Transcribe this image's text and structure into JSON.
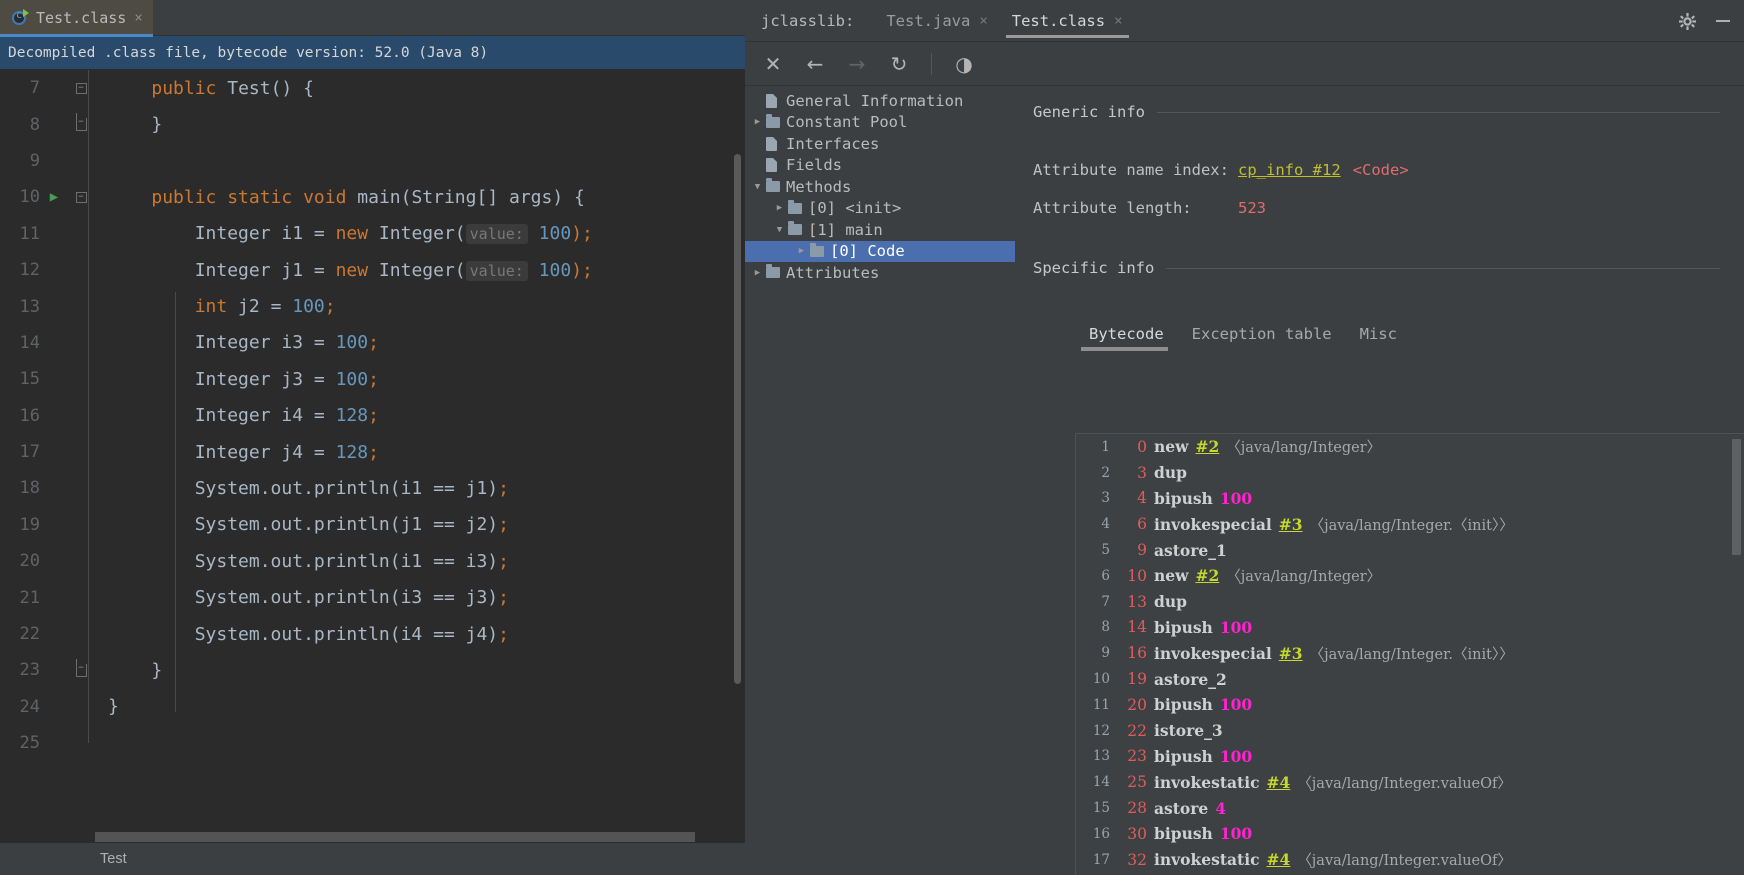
{
  "editor": {
    "tab": {
      "title": "Test.class",
      "close": "×",
      "icon": "java-class-icon"
    },
    "notice": "Decompiled .class file, bytecode version: 52.0 (Java 8)",
    "breadcrumb": "Test",
    "lines": [
      {
        "num": "7",
        "fold": "start",
        "run": false,
        "tokens": [
          {
            "t": "    ",
            "c": "pl"
          },
          {
            "t": "public",
            "c": "kw"
          },
          {
            "t": " Test() {",
            "c": "pl"
          }
        ]
      },
      {
        "num": "8",
        "fold": "end",
        "run": false,
        "tokens": [
          {
            "t": "    }",
            "c": "pl"
          }
        ]
      },
      {
        "num": "9",
        "fold": "none",
        "run": false,
        "tokens": []
      },
      {
        "num": "10",
        "fold": "start",
        "run": true,
        "tokens": [
          {
            "t": "    ",
            "c": "pl"
          },
          {
            "t": "public static void",
            "c": "kw"
          },
          {
            "t": " main(String[] args) {",
            "c": "pl"
          }
        ]
      },
      {
        "num": "11",
        "fold": "none",
        "run": false,
        "tokens": [
          {
            "t": "        Integer i1 = ",
            "c": "pl"
          },
          {
            "t": "new",
            "c": "kw"
          },
          {
            "t": " Integer(",
            "c": "pl"
          },
          {
            "t": "value:",
            "c": "hint"
          },
          {
            "t": " ",
            "c": "pl"
          },
          {
            "t": "100",
            "c": "num"
          },
          {
            "t": ");",
            "c": "sc"
          }
        ]
      },
      {
        "num": "12",
        "fold": "none",
        "run": false,
        "tokens": [
          {
            "t": "        Integer j1 = ",
            "c": "pl"
          },
          {
            "t": "new",
            "c": "kw"
          },
          {
            "t": " Integer(",
            "c": "pl"
          },
          {
            "t": "value:",
            "c": "hint"
          },
          {
            "t": " ",
            "c": "pl"
          },
          {
            "t": "100",
            "c": "num"
          },
          {
            "t": ");",
            "c": "sc"
          }
        ]
      },
      {
        "num": "13",
        "fold": "none",
        "run": false,
        "tokens": [
          {
            "t": "        ",
            "c": "pl"
          },
          {
            "t": "int",
            "c": "kw"
          },
          {
            "t": " j2 = ",
            "c": "pl"
          },
          {
            "t": "100",
            "c": "num"
          },
          {
            "t": ";",
            "c": "sc"
          }
        ]
      },
      {
        "num": "14",
        "fold": "none",
        "run": false,
        "tokens": [
          {
            "t": "        Integer i3 = ",
            "c": "pl"
          },
          {
            "t": "100",
            "c": "num"
          },
          {
            "t": ";",
            "c": "sc"
          }
        ]
      },
      {
        "num": "15",
        "fold": "none",
        "run": false,
        "tokens": [
          {
            "t": "        Integer j3 = ",
            "c": "pl"
          },
          {
            "t": "100",
            "c": "num"
          },
          {
            "t": ";",
            "c": "sc"
          }
        ]
      },
      {
        "num": "16",
        "fold": "none",
        "run": false,
        "tokens": [
          {
            "t": "        Integer i4 = ",
            "c": "pl"
          },
          {
            "t": "128",
            "c": "num"
          },
          {
            "t": ";",
            "c": "sc"
          }
        ]
      },
      {
        "num": "17",
        "fold": "none",
        "run": false,
        "tokens": [
          {
            "t": "        Integer j4 = ",
            "c": "pl"
          },
          {
            "t": "128",
            "c": "num"
          },
          {
            "t": ";",
            "c": "sc"
          }
        ]
      },
      {
        "num": "18",
        "fold": "none",
        "run": false,
        "tokens": [
          {
            "t": "        System.out.println(i1 == j1)",
            "c": "pl"
          },
          {
            "t": ";",
            "c": "sc"
          }
        ]
      },
      {
        "num": "19",
        "fold": "none",
        "run": false,
        "tokens": [
          {
            "t": "        System.out.println(j1 == j2)",
            "c": "pl"
          },
          {
            "t": ";",
            "c": "sc"
          }
        ]
      },
      {
        "num": "20",
        "fold": "none",
        "run": false,
        "tokens": [
          {
            "t": "        System.out.println(i1 == i3)",
            "c": "pl"
          },
          {
            "t": ";",
            "c": "sc"
          }
        ]
      },
      {
        "num": "21",
        "fold": "none",
        "run": false,
        "tokens": [
          {
            "t": "        System.out.println(i3 == j3)",
            "c": "pl"
          },
          {
            "t": ";",
            "c": "sc"
          }
        ]
      },
      {
        "num": "22",
        "fold": "none",
        "run": false,
        "tokens": [
          {
            "t": "        System.out.println(i4 == j4)",
            "c": "pl"
          },
          {
            "t": ";",
            "c": "sc"
          }
        ]
      },
      {
        "num": "23",
        "fold": "end",
        "run": false,
        "tokens": [
          {
            "t": "    }",
            "c": "pl"
          }
        ]
      },
      {
        "num": "24",
        "fold": "none",
        "run": false,
        "tokens": [
          {
            "t": "}",
            "c": "pl"
          }
        ]
      },
      {
        "num": "25",
        "fold": "none",
        "run": false,
        "tokens": []
      }
    ]
  },
  "jclasslib": {
    "label": "jclasslib:",
    "tabs": [
      {
        "label": "Test.java",
        "active": false,
        "close": "×"
      },
      {
        "label": "Test.class",
        "active": true,
        "close": "×"
      }
    ],
    "window_controls": [
      {
        "name": "gear-icon",
        "label": ""
      },
      {
        "name": "minimize-icon",
        "label": ""
      }
    ],
    "toolbar": [
      {
        "name": "close-icon",
        "glyph": "✕",
        "dim": false
      },
      {
        "name": "back-icon",
        "glyph": "←",
        "dim": false
      },
      {
        "name": "forward-icon",
        "glyph": "→",
        "dim": true
      },
      {
        "name": "reload-icon",
        "glyph": "↻",
        "dim": false
      },
      {
        "name": "browse-icon",
        "glyph": "◑",
        "dim": false
      }
    ],
    "tree": [
      {
        "label": "General Information",
        "indent": 1,
        "arrow": "none",
        "icon": "file",
        "selected": false
      },
      {
        "label": "Constant Pool",
        "indent": 1,
        "arrow": "collapsed",
        "icon": "folder",
        "selected": false
      },
      {
        "label": "Interfaces",
        "indent": 1,
        "arrow": "none",
        "icon": "file",
        "selected": false
      },
      {
        "label": "Fields",
        "indent": 1,
        "arrow": "none",
        "icon": "file",
        "selected": false
      },
      {
        "label": "Methods",
        "indent": 1,
        "arrow": "expanded",
        "icon": "folder",
        "selected": false
      },
      {
        "label": "[0] <init>",
        "indent": 2,
        "arrow": "collapsed",
        "icon": "folder",
        "selected": false
      },
      {
        "label": "[1] main",
        "indent": 2,
        "arrow": "expanded",
        "icon": "folder",
        "selected": false
      },
      {
        "label": "[0] Code",
        "indent": 3,
        "arrow": "collapsed",
        "icon": "folder",
        "selected": true
      },
      {
        "label": "Attributes",
        "indent": 1,
        "arrow": "collapsed",
        "icon": "folder",
        "selected": false
      }
    ],
    "detail": {
      "generic_header": "Generic info",
      "specific_header": "Specific info",
      "rows": [
        {
          "key": "Attribute name index:",
          "link": "cp_info #12",
          "extra": "<Code>",
          "value": ""
        },
        {
          "key": "Attribute length:",
          "link": "",
          "extra": "",
          "value": "523"
        }
      ]
    },
    "bytecode_tabs": [
      {
        "label": "Bytecode",
        "active": true
      },
      {
        "label": "Exception table",
        "active": false
      },
      {
        "label": "Misc",
        "active": false
      }
    ],
    "bytecode": [
      {
        "idx": "1",
        "offset": "0",
        "op": "new",
        "ref": "#2",
        "lit": "",
        "desc": "〈java/lang/Integer〉"
      },
      {
        "idx": "2",
        "offset": "3",
        "op": "dup",
        "ref": "",
        "lit": "",
        "desc": ""
      },
      {
        "idx": "3",
        "offset": "4",
        "op": "bipush",
        "ref": "",
        "lit": "100",
        "desc": ""
      },
      {
        "idx": "4",
        "offset": "6",
        "op": "invokespecial",
        "ref": "#3",
        "lit": "",
        "desc": "〈java/lang/Integer.〈init〉〉"
      },
      {
        "idx": "5",
        "offset": "9",
        "op": "astore_1",
        "ref": "",
        "lit": "",
        "desc": ""
      },
      {
        "idx": "6",
        "offset": "10",
        "op": "new",
        "ref": "#2",
        "lit": "",
        "desc": "〈java/lang/Integer〉"
      },
      {
        "idx": "7",
        "offset": "13",
        "op": "dup",
        "ref": "",
        "lit": "",
        "desc": ""
      },
      {
        "idx": "8",
        "offset": "14",
        "op": "bipush",
        "ref": "",
        "lit": "100",
        "desc": ""
      },
      {
        "idx": "9",
        "offset": "16",
        "op": "invokespecial",
        "ref": "#3",
        "lit": "",
        "desc": "〈java/lang/Integer.〈init〉〉"
      },
      {
        "idx": "10",
        "offset": "19",
        "op": "astore_2",
        "ref": "",
        "lit": "",
        "desc": ""
      },
      {
        "idx": "11",
        "offset": "20",
        "op": "bipush",
        "ref": "",
        "lit": "100",
        "desc": ""
      },
      {
        "idx": "12",
        "offset": "22",
        "op": "istore_3",
        "ref": "",
        "lit": "",
        "desc": ""
      },
      {
        "idx": "13",
        "offset": "23",
        "op": "bipush",
        "ref": "",
        "lit": "100",
        "desc": ""
      },
      {
        "idx": "14",
        "offset": "25",
        "op": "invokestatic",
        "ref": "#4",
        "lit": "",
        "desc": "〈java/lang/Integer.valueOf〉"
      },
      {
        "idx": "15",
        "offset": "28",
        "op": "astore",
        "ref": "",
        "lit": "4",
        "desc": ""
      },
      {
        "idx": "16",
        "offset": "30",
        "op": "bipush",
        "ref": "",
        "lit": "100",
        "desc": ""
      },
      {
        "idx": "17",
        "offset": "32",
        "op": "invokestatic",
        "ref": "#4",
        "lit": "",
        "desc": "〈java/lang/Integer.valueOf〉"
      }
    ]
  },
  "colors": {
    "editor_bg": "#2b2b2b",
    "panel_bg": "#3c3f41",
    "notice_bg": "#2a4a6b",
    "keyword": "#cc7832",
    "number": "#6897bb",
    "plain": "#a9b7c6",
    "selection": "#4b6eaf",
    "cp_link": "#bfbf2f",
    "bc_offset": "#e05c5c",
    "bc_literal": "#ff22d0",
    "bc_ref": "#c8d82a"
  }
}
